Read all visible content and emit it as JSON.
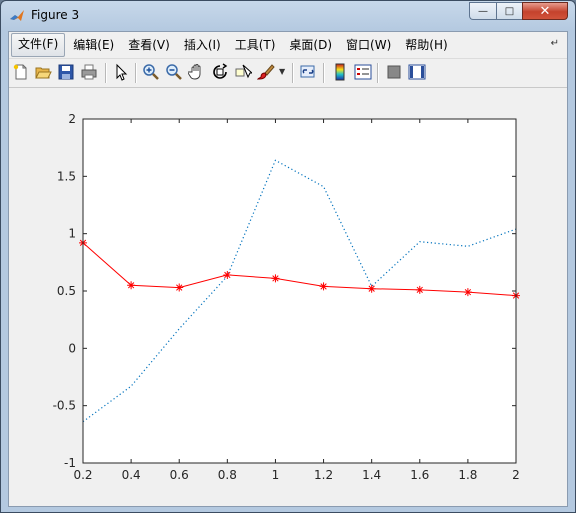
{
  "window": {
    "title": "Figure 3"
  },
  "menu": {
    "items": [
      {
        "label": "文件(F)"
      },
      {
        "label": "编辑(E)"
      },
      {
        "label": "查看(V)"
      },
      {
        "label": "插入(I)"
      },
      {
        "label": "工具(T)"
      },
      {
        "label": "桌面(D)"
      },
      {
        "label": "窗口(W)"
      },
      {
        "label": "帮助(H)"
      }
    ]
  },
  "toolbar": {
    "icons": [
      "new-figure-icon",
      "open-file-icon",
      "save-icon",
      "print-icon",
      "pointer-icon",
      "zoom-in-icon",
      "zoom-out-icon",
      "pan-hand-icon",
      "rotate-3d-icon",
      "data-cursor-icon",
      "brush-icon",
      "link-plot-icon",
      "colorbar-icon",
      "legend-icon",
      "hide-plot-tools-icon",
      "show-plot-tools-icon"
    ]
  },
  "colors": {
    "red_series": "#ff0000",
    "dotted_series": "#0072bd"
  },
  "chart_data": {
    "type": "line",
    "xlim": [
      0.2,
      2
    ],
    "ylim": [
      -1,
      2
    ],
    "xticks": [
      "0.2",
      "0.4",
      "0.6",
      "0.8",
      "1",
      "1.2",
      "1.4",
      "1.6",
      "1.8",
      "2"
    ],
    "yticks": [
      "-1",
      "-0.5",
      "0",
      "0.5",
      "1",
      "1.5",
      "2"
    ],
    "grid": false,
    "x": [
      0.2,
      0.4,
      0.6,
      0.8,
      1.0,
      1.2,
      1.4,
      1.6,
      1.8,
      2.0
    ],
    "series": [
      {
        "style": "dotted",
        "color": "#0072bd",
        "values": [
          -0.64,
          -0.33,
          0.17,
          0.63,
          1.64,
          1.41,
          0.54,
          0.93,
          0.89,
          1.04
        ]
      },
      {
        "style": "solid-asterisk",
        "color": "#ff0000",
        "values": [
          0.92,
          0.55,
          0.53,
          0.64,
          0.61,
          0.54,
          0.52,
          0.51,
          0.49,
          0.46
        ]
      }
    ]
  }
}
